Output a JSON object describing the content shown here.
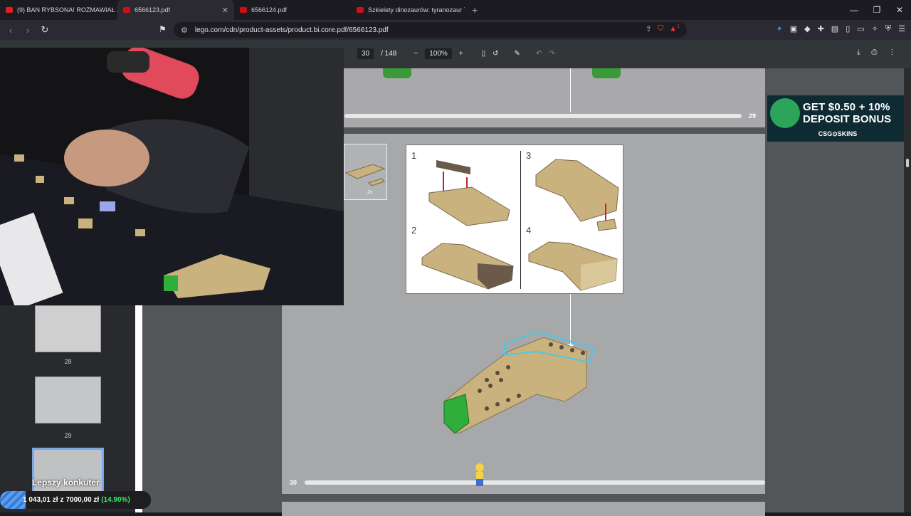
{
  "tabs": [
    {
      "label": "(9) BAN RYBSONA! ROZMAWIAŁ Z D",
      "color": "#e02020",
      "active": false
    },
    {
      "label": "6566123.pdf",
      "color": "#d01010",
      "active": true
    },
    {
      "label": "6566124.pdf",
      "color": "#d01010",
      "active": false
    },
    {
      "label": "Szkielety dinozaurów: tyranozaur 76",
      "color": "#d01010",
      "active": false
    }
  ],
  "address": {
    "url": "lego.com/cdn/product-assets/product.bi.core.pdf/6566123.pdf",
    "shield_badge": "1"
  },
  "pdf": {
    "current_page": "30",
    "total_pages": "/ 148",
    "zoom": "100%"
  },
  "thumbnails": [
    {
      "num": "28"
    },
    {
      "num": "29"
    },
    {
      "num": ""
    }
  ],
  "pages": {
    "p29_num": "29",
    "p30_num": "30",
    "parts_count": "2x"
  },
  "steps": [
    "1",
    "2",
    "3",
    "4"
  ],
  "ad": {
    "line1": "GET $0.50 + 10%",
    "line2": "DEPOSIT BONUS",
    "brand": "CSG⊙SKINS"
  },
  "stream": {
    "title": "Lepszy konkuter",
    "goal_current": "1 043,01 zł",
    "goal_sep": "z",
    "goal_target": "7000,00 zł",
    "goal_percent": "(14.90%)"
  }
}
